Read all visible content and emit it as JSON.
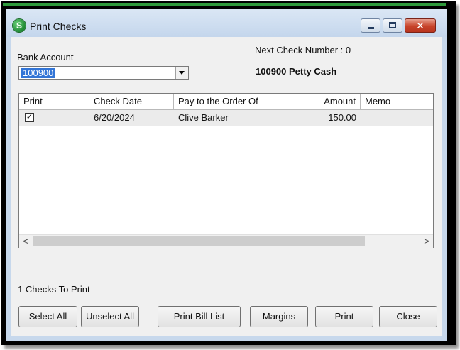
{
  "window": {
    "title": "Print Checks",
    "app_icon_letter": "S",
    "close_glyph": "✕"
  },
  "form": {
    "bank_account_label": "Bank Account",
    "bank_account_value": "100900",
    "next_check_label": "Next Check Number : 0",
    "account_name": "100900 Petty Cash"
  },
  "grid": {
    "columns": [
      "Print",
      "Check Date",
      "Pay to the Order Of",
      "Amount",
      "Memo"
    ],
    "rows": [
      {
        "print": true,
        "check_mark": "✓",
        "check_date": "6/20/2024",
        "pay_to": "Clive Barker",
        "amount": "150.00",
        "memo": ""
      }
    ],
    "scroll_left": "<",
    "scroll_right": ">"
  },
  "footer": {
    "count_label": "1 Checks To Print"
  },
  "buttons": {
    "select_all": "Select All",
    "unselect_all": "Unselect All",
    "print_bill_list": "Print Bill List",
    "margins": "Margins",
    "print": "Print",
    "close": "Close"
  },
  "colors": {
    "accent_strip": "#2f9a3c",
    "titlebar": "#c7d8ec",
    "selection": "#3375d6"
  }
}
